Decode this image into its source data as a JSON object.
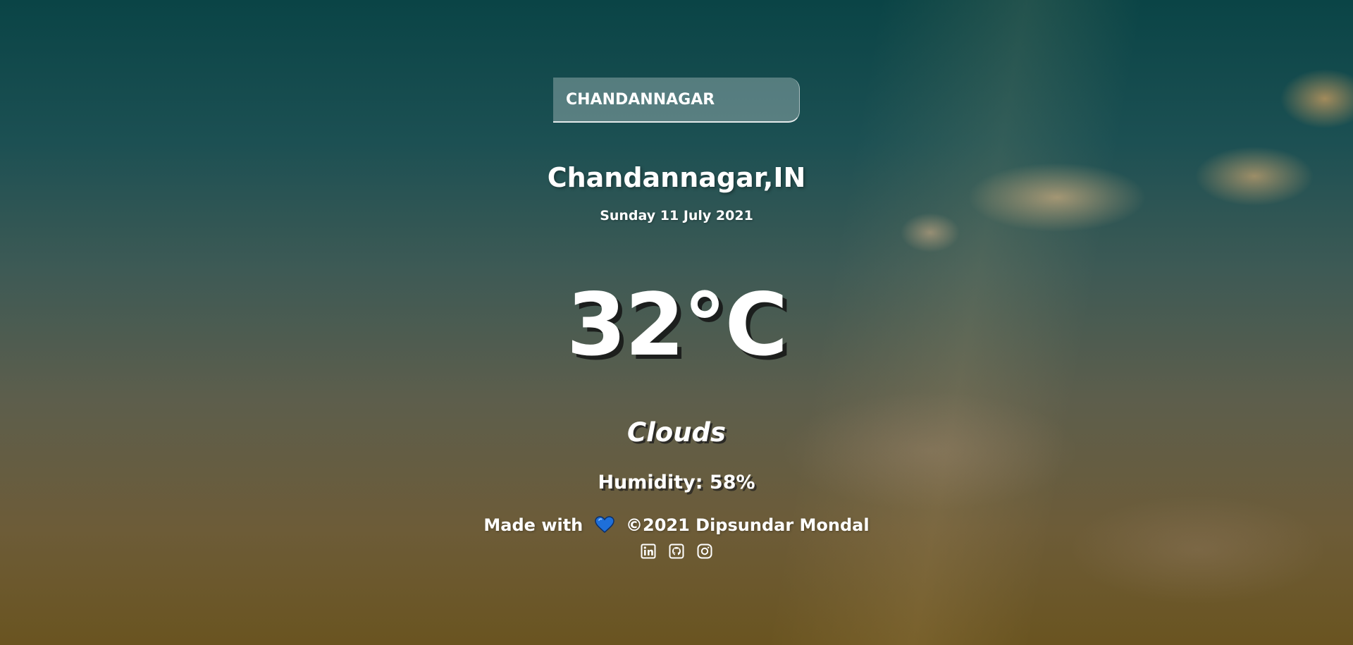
{
  "search": {
    "value": "CHANDANNAGAR"
  },
  "location": {
    "text": "Chandannagar,IN"
  },
  "date": {
    "text": "Sunday 11 July 2021"
  },
  "weather": {
    "temperature": "32°C",
    "condition": "Clouds",
    "humidity": "Humidity: 58%"
  },
  "footer": {
    "made_with": "Made with",
    "heart_icon": "blue-heart-icon",
    "copyright": "©2021 Dipsundar Mondal",
    "socials": [
      {
        "icon": "linkedin-icon"
      },
      {
        "icon": "github-icon"
      },
      {
        "icon": "instagram-icon"
      }
    ]
  },
  "colors": {
    "text": "#ffffff",
    "heart": "#1e6fd9"
  }
}
